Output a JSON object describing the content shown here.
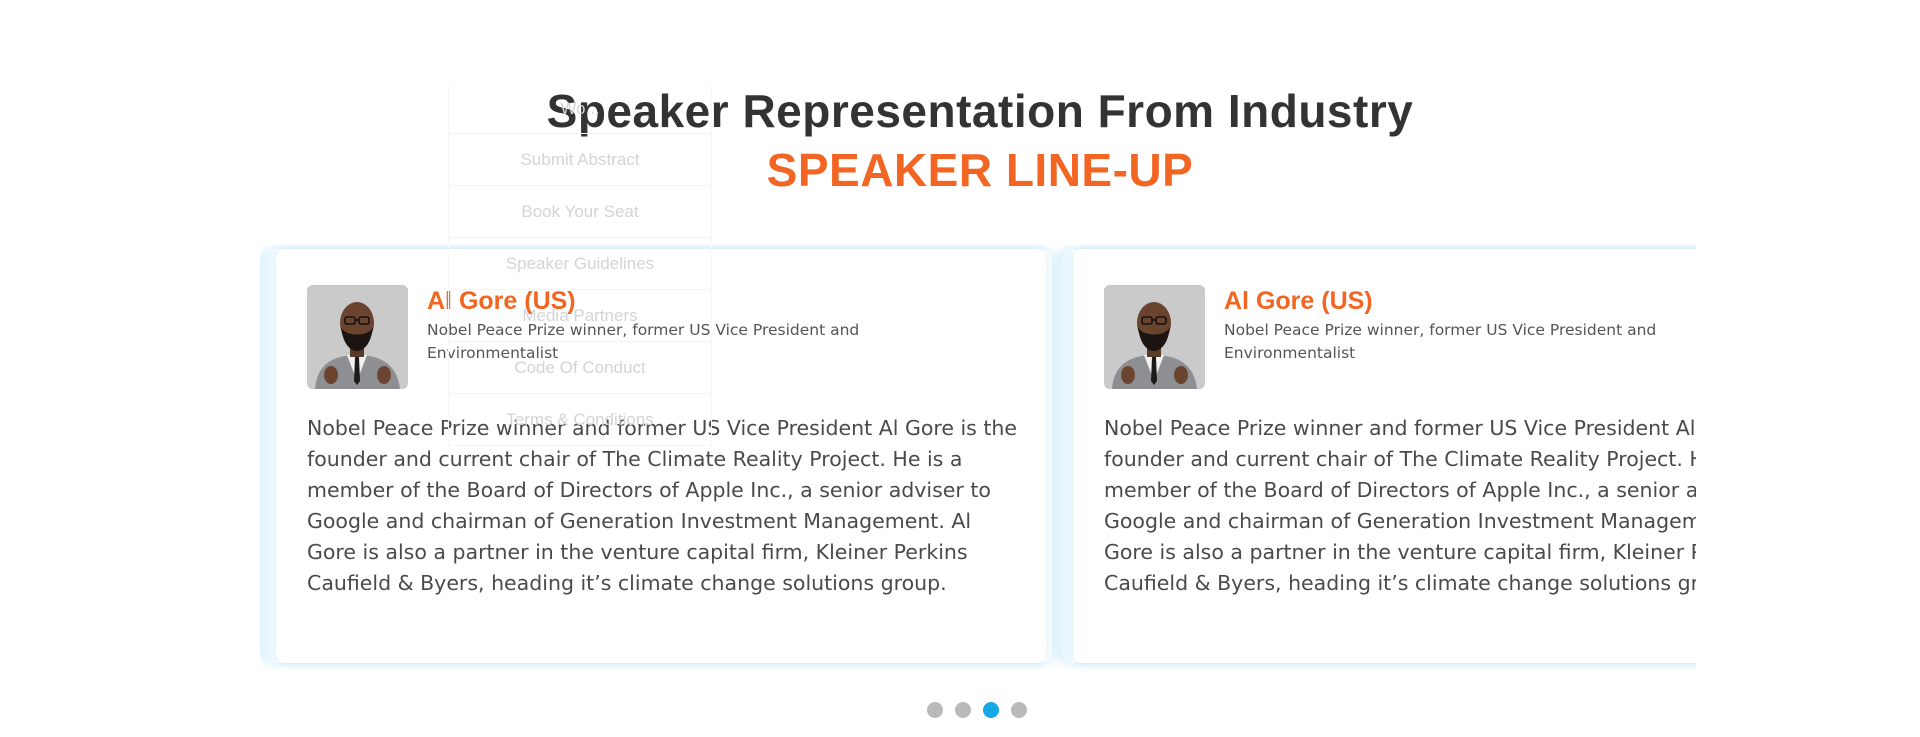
{
  "section": {
    "title": "Speaker Representation From Industry",
    "subtitle": "SPEAKER LINE-UP"
  },
  "menu_overlay": {
    "items": [
      "Wo...",
      "Submit Abstract",
      "Book Your Seat",
      "Speaker Guidelines",
      "Media Partners",
      "Code Of Conduct",
      "Terms & Conditions"
    ]
  },
  "speakers": [
    {
      "name": "Al Gore (US)",
      "role": "Nobel Peace Prize winner, former US Vice President and Environmentalist",
      "bio": "Nobel Peace Prize winner and former US Vice President Al Gore is the founder and current chair of The Climate Reality Project. He is a member of the Board of Directors of Apple Inc., a senior adviser to Google and chairman of Generation Investment Management. Al Gore is also a partner in the venture capital firm, Kleiner Perkins Caufield & Byers, heading it’s climate change solutions group.",
      "photo_icon": "speaker-portrait"
    },
    {
      "name": "Al Gore (US)",
      "role": "Nobel Peace Prize winner, former US Vice President and Environmentalist",
      "bio": "Nobel Peace Prize winner and former US Vice President Al Gore is the founder and current chair of The Climate Reality Project. He is a member of the Board of Directors of Apple Inc., a senior adviser to Google and chairman of Generation Investment Management. Al Gore is also a partner in the venture capital firm, Kleiner Perkins Caufield & Byers, heading it’s climate change solutions group.",
      "photo_icon": "speaker-portrait"
    }
  ],
  "pagination": {
    "total": 4,
    "active_index": 2
  },
  "colors": {
    "accent": "#f26522",
    "heading": "#333333",
    "dot_active": "#17a8e8",
    "dot_inactive": "#b9b9b9"
  }
}
